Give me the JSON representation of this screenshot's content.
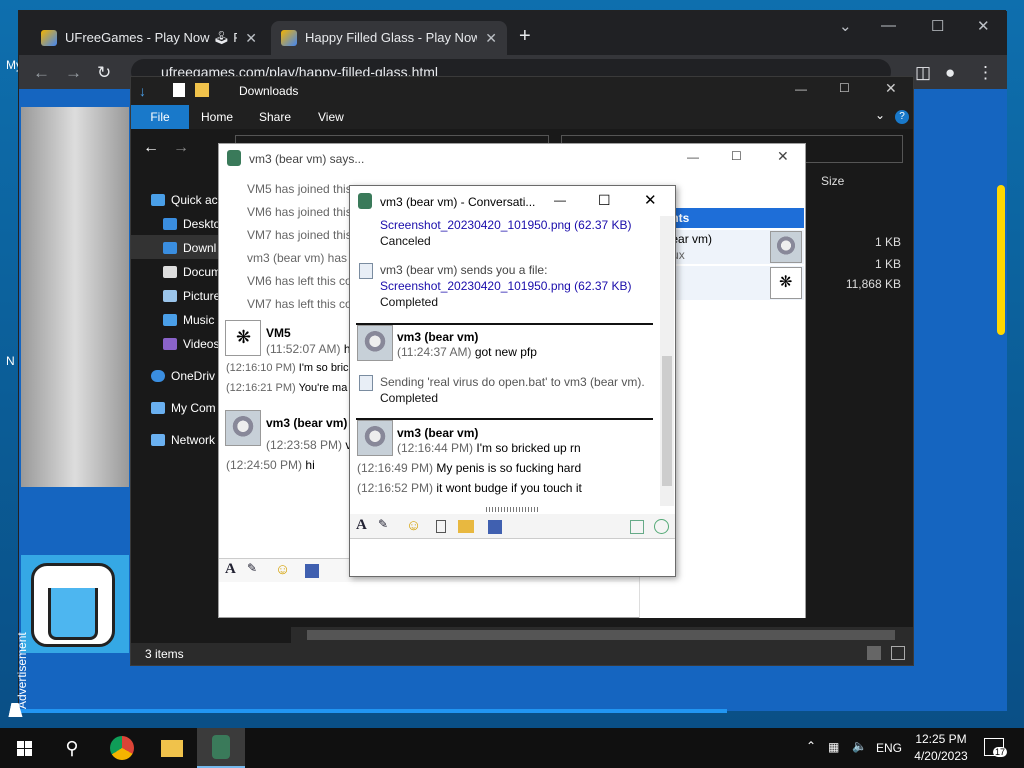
{
  "desktop": {
    "icon_labels": [
      "My",
      "N"
    ]
  },
  "chrome": {
    "tabs": [
      {
        "title": "UFreeGames - Play Now 🕹 Play",
        "close": "✕"
      },
      {
        "title": "Happy Filled Glass - Play Now 🕹",
        "close": "✕"
      }
    ],
    "new_tab": "+",
    "url": "ufreegames.com/play/happy-filled-glass.html",
    "advertisement": "Advertisement"
  },
  "explorer": {
    "title": "Downloads",
    "ribbon": {
      "file": "File",
      "home": "Home",
      "share": "Share",
      "view": "View"
    },
    "nav": [
      {
        "label": "Quick ac",
        "color": "#4a9fe8"
      },
      {
        "label": "Deskto",
        "color": "#3a8ee0"
      },
      {
        "label": "Downl",
        "color": "#3a8ee0"
      },
      {
        "label": "Docum",
        "color": "#dddddd"
      },
      {
        "label": "Picture",
        "color": "#9ac4ea"
      },
      {
        "label": "Music",
        "color": "#4a9fe8"
      },
      {
        "label": "Videos",
        "color": "#8a63c9"
      },
      {
        "label": "OneDriv",
        "color": "#3a8ee0"
      },
      {
        "label": "My Com",
        "color": "#6ab0f0"
      },
      {
        "label": "Network",
        "color": "#6ab0f0"
      }
    ],
    "size_header": "Size",
    "file_sizes": [
      "1 KB",
      "1 KB",
      "11,868 KB"
    ],
    "status": "3 items"
  },
  "messenger_back": {
    "title": "vm3 (bear vm) says...",
    "system_lines": [
      "VM5 has joined this",
      "VM6 has joined this",
      "VM7 has joined this",
      "vm3 (bear vm) has",
      "VM6 has left this co",
      "VM7 has left this co"
    ],
    "blocks": [
      {
        "name": "VM5",
        "lines": [
          {
            "ts": "(11:52:07 AM)",
            "text": "h"
          },
          {
            "ts": "(12:16:10 PM)",
            "text": "I'm so bric"
          },
          {
            "ts": "(12:16:21 PM)",
            "text": "You're ma"
          }
        ]
      },
      {
        "name": "vm3 (bear vm)",
        "lines": [
          {
            "ts": "(12:23:58 PM)",
            "text": "v"
          },
          {
            "ts": "(12:24:50 PM)",
            "text": "hi"
          }
        ]
      }
    ],
    "participants_header": "icipants",
    "participants": [
      {
        "name": "n3 (bear vm)",
        "sub": "ch linux"
      },
      {
        "name": "M5",
        "sub": ""
      }
    ]
  },
  "conversation": {
    "title": "vm3 (bear vm) - Conversati...",
    "entries": [
      {
        "file": "Screenshot_20230420_101950.png (62.37 KB)",
        "status": "Canceled"
      },
      {
        "intro": "vm3 (bear vm) sends you a file:",
        "file": "Screenshot_20230420_101950.png (62.37 KB)",
        "status": "Completed"
      }
    ],
    "msg1": {
      "name": "vm3 (bear vm)",
      "ts": "(11:24:37 AM)",
      "text": "got new pfp"
    },
    "sending": {
      "text": "Sending 'real virus do open.bat' to vm3 (bear vm).",
      "status": "Completed"
    },
    "msg2": {
      "name": "vm3 (bear vm)",
      "lines": [
        {
          "ts": "(12:16:44 PM)",
          "text": "I'm so bricked up rn"
        },
        {
          "ts": "(12:16:49 PM)",
          "text": "My penis is so fucking hard"
        },
        {
          "ts": "(12:16:52 PM)",
          "text": "it wont budge if you touch it"
        }
      ]
    },
    "font_icon": "A",
    "emoji_icon": "☺"
  },
  "taskbar": {
    "time": "12:25 PM",
    "date": "4/20/2023",
    "lang": "ENG",
    "notif_count": "17"
  }
}
